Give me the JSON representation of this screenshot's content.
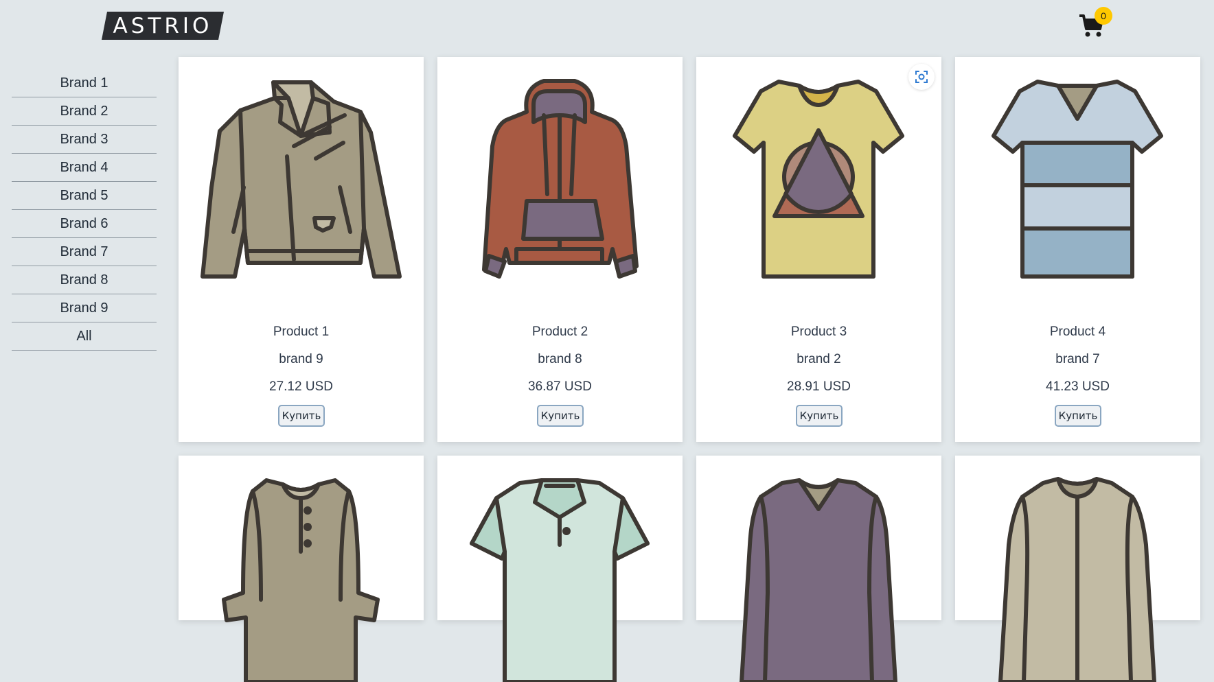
{
  "header": {
    "logo_text": "ASTRIO",
    "cart_count": "0"
  },
  "sidebar": {
    "items": [
      {
        "label": "Brand 1"
      },
      {
        "label": "Brand 2"
      },
      {
        "label": "Brand 3"
      },
      {
        "label": "Brand 4"
      },
      {
        "label": "Brand 5"
      },
      {
        "label": "Brand 6"
      },
      {
        "label": "Brand 7"
      },
      {
        "label": "Brand 8"
      },
      {
        "label": "Brand 9"
      },
      {
        "label": "All"
      }
    ]
  },
  "products": [
    {
      "name": "Product 1",
      "brand": "brand 9",
      "price": "27.12 USD",
      "buy_label": "Купить",
      "icon": "biker-jacket-icon"
    },
    {
      "name": "Product 2",
      "brand": "brand 8",
      "price": "36.87 USD",
      "buy_label": "Купить",
      "icon": "hoodie-icon"
    },
    {
      "name": "Product 3",
      "brand": "brand 2",
      "price": "28.91 USD",
      "buy_label": "Купить",
      "icon": "graphic-tshirt-icon"
    },
    {
      "name": "Product 4",
      "brand": "brand 7",
      "price": "41.23 USD",
      "buy_label": "Купить",
      "icon": "striped-tshirt-icon"
    },
    {
      "icon": "henley-shirt-icon"
    },
    {
      "icon": "polo-shirt-icon"
    },
    {
      "icon": "sweater-icon"
    },
    {
      "icon": "cardigan-icon"
    }
  ],
  "colors": {
    "background": "#e1e7ea",
    "card": "#ffffff",
    "badge": "#ffc800",
    "outline": "#3d3833"
  }
}
